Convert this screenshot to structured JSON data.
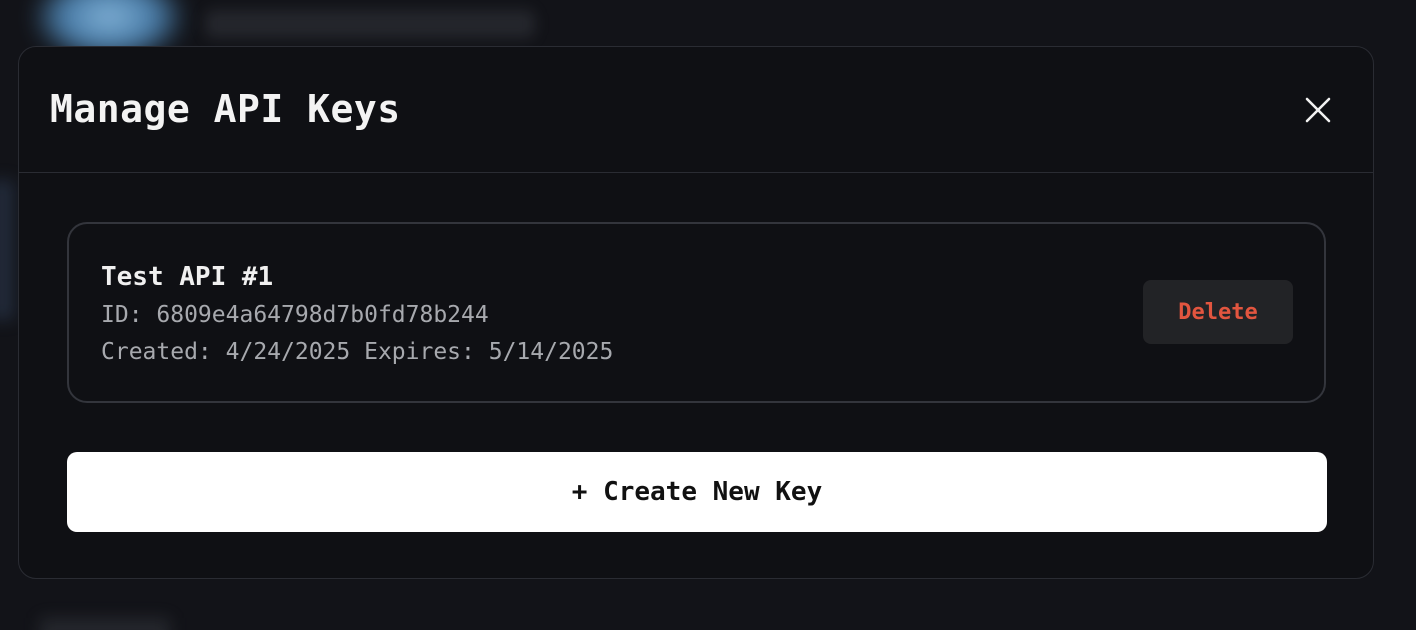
{
  "modal": {
    "title": "Manage API Keys",
    "close_icon": "close-icon"
  },
  "api_keys": [
    {
      "name": "Test API #1",
      "id_text": "ID: 6809e4a64798d7b0fd78b244",
      "dates_text": "Created: 4/24/2025 Expires: 5/14/2025",
      "delete_label": "Delete"
    }
  ],
  "actions": {
    "create_label": "+ Create New Key"
  },
  "colors": {
    "danger": "#e2553f",
    "primary_button_bg": "#ffffff",
    "modal_bg": "#0f1014"
  }
}
